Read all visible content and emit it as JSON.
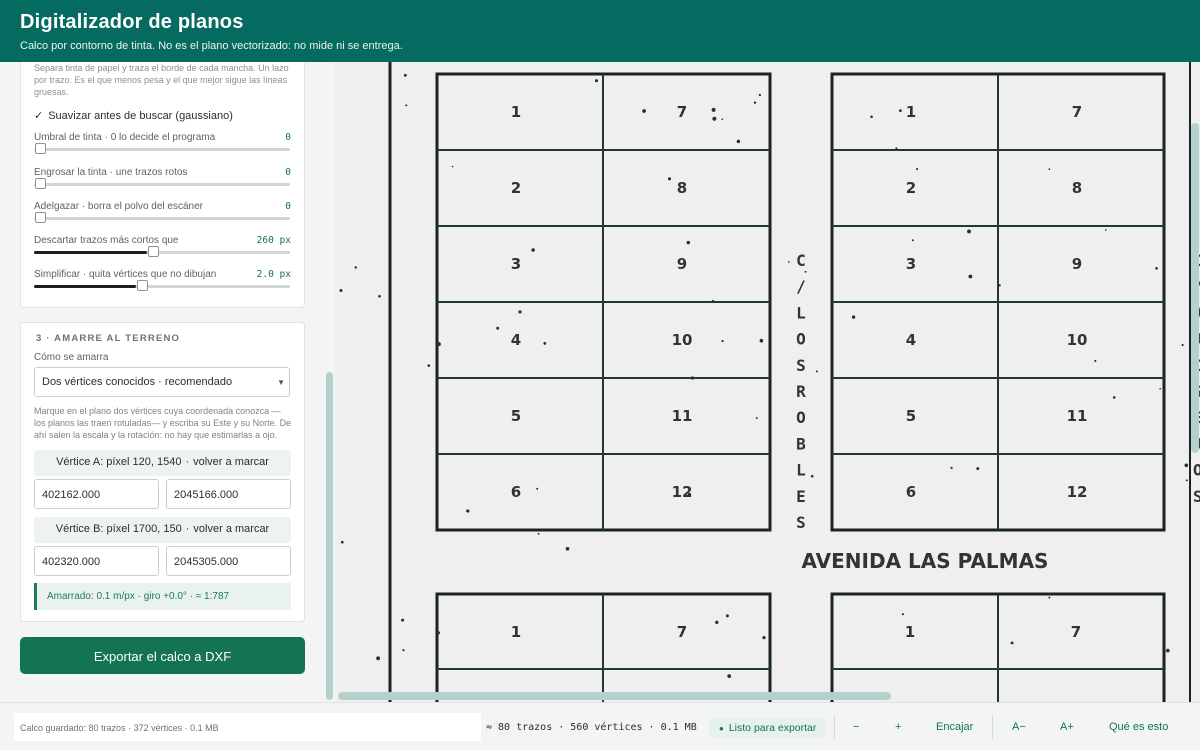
{
  "header": {
    "title": "Digitalizador de planos",
    "subtitle": "Calco por contorno de tinta. No es el plano vectorizado: no mide ni se entrega."
  },
  "trace": {
    "hint": "Separa tinta de papel y traza el borde de cada mancha. Un lazo por trazo. Es el que menos pesa y el que mejor sigue las líneas gruesas.",
    "smooth_label": "Suavizar antes de buscar (gaussiano)",
    "smooth_checked": true,
    "sliders": [
      {
        "label": "Umbral de tinta  ·  0 lo decide el programa",
        "value": "0",
        "fraction": 0.0
      },
      {
        "label": "Engrosar la tinta · une trazos rotos",
        "value": "0",
        "fraction": 0.0
      },
      {
        "label": "Adelgazar · borra el polvo del escáner",
        "value": "0",
        "fraction": 0.0
      },
      {
        "label": "Descartar trazos más cortos que",
        "value": "260 px",
        "fraction": 0.44
      },
      {
        "label": "Simplificar · quita vértices que no dibujan",
        "value": "2.0 px",
        "fraction": 0.4
      }
    ]
  },
  "anchor": {
    "section_title": "3 · AMARRE AL TERRENO",
    "method_label": "Cómo se amarra",
    "method_value": "Dos vértices conocidos · recomendado",
    "description": "Marque en el plano dos vértices cuya coordenada conozca — los planos las traen rotuladas— y escriba su Este y su Norte. De ahí salen la escala y la rotación: no hay que estimarlas a ojo.",
    "vertex_a": {
      "label": "Vértice A: píxel 120, 1540",
      "remark": "volver a marcar",
      "east": "402162.000",
      "north": "2045166.000"
    },
    "vertex_b": {
      "label": "Vértice B: píxel 1700, 150",
      "remark": "volver a marcar",
      "east": "402320.000",
      "north": "2045305.000"
    },
    "result": "Amarrado:  0.1 m/px  ·  giro +0.0°  ·  ≈ 1:787"
  },
  "export_label": "Exportar el calco a DXF",
  "plan": {
    "street_vertical": "C/LOSROBLES",
    "street_horizontal": "AVENIDA LAS PALMAS",
    "left_lots": [
      "1",
      "2",
      "3",
      "4",
      "5",
      "6"
    ],
    "right_lots": [
      "7",
      "8",
      "9",
      "10",
      "11",
      "12"
    ],
    "bottom_left_lots": [
      "1"
    ],
    "bottom_right_lots": [
      "7"
    ],
    "edge_letters": [
      "C",
      "/",
      "A",
      "R",
      "C",
      "S",
      "E",
      "R",
      "O",
      "S"
    ]
  },
  "status": {
    "saved": "Calco guardado: 80 trazos · 372 vértices · 0.1 MB",
    "stats": "≈ 80 trazos · 560 vértices · 0.1 MB",
    "ready": "Listo para exportar",
    "zoom_out": "−",
    "zoom_in": "+",
    "fit": "Encajar",
    "font_smaller": "A−",
    "font_larger": "A+",
    "about": "Qué es esto"
  }
}
